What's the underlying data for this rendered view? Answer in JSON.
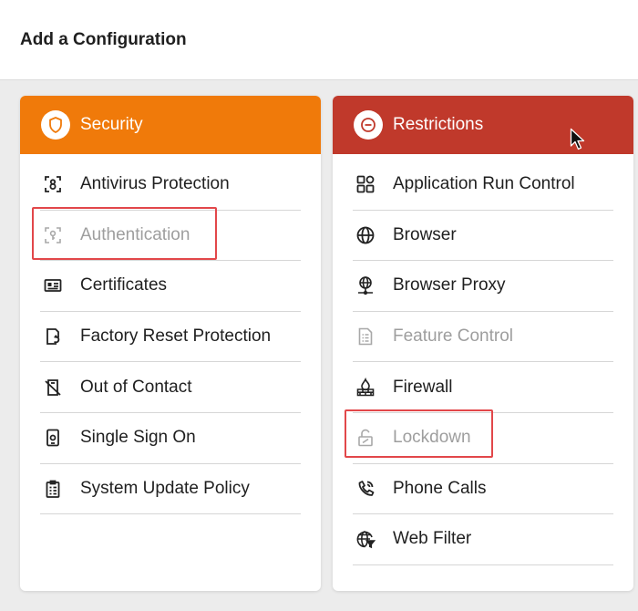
{
  "page": {
    "title": "Add a Configuration"
  },
  "security": {
    "title": "Security",
    "items": [
      {
        "label": "Antivirus Protection",
        "icon": "antivirus-icon",
        "disabled": false
      },
      {
        "label": "Authentication",
        "icon": "authentication-icon",
        "disabled": true
      },
      {
        "label": "Certificates",
        "icon": "certificate-icon",
        "disabled": false
      },
      {
        "label": "Factory Reset Protection",
        "icon": "factory-reset-icon",
        "disabled": false
      },
      {
        "label": "Out of Contact",
        "icon": "out-of-contact-icon",
        "disabled": false
      },
      {
        "label": "Single Sign On",
        "icon": "single-sign-on-icon",
        "disabled": false
      },
      {
        "label": "System Update Policy",
        "icon": "system-update-icon",
        "disabled": false
      }
    ]
  },
  "restrictions": {
    "title": "Restrictions",
    "items": [
      {
        "label": "Application Run Control",
        "icon": "app-grid-icon",
        "disabled": false
      },
      {
        "label": "Browser",
        "icon": "globe-icon",
        "disabled": false
      },
      {
        "label": "Browser Proxy",
        "icon": "network-globe-icon",
        "disabled": false
      },
      {
        "label": "Feature Control",
        "icon": "document-list-icon",
        "disabled": true
      },
      {
        "label": "Firewall",
        "icon": "firewall-icon",
        "disabled": false
      },
      {
        "label": "Lockdown",
        "icon": "lock-open-icon",
        "disabled": true
      },
      {
        "label": "Phone Calls",
        "icon": "phone-icon",
        "disabled": false
      },
      {
        "label": "Web Filter",
        "icon": "web-filter-icon",
        "disabled": false
      }
    ]
  },
  "colors": {
    "security_header": "#f07a0a",
    "restrictions_header": "#c0392b",
    "highlight_box": "#e2474a",
    "disabled_text": "#9e9e9e"
  }
}
